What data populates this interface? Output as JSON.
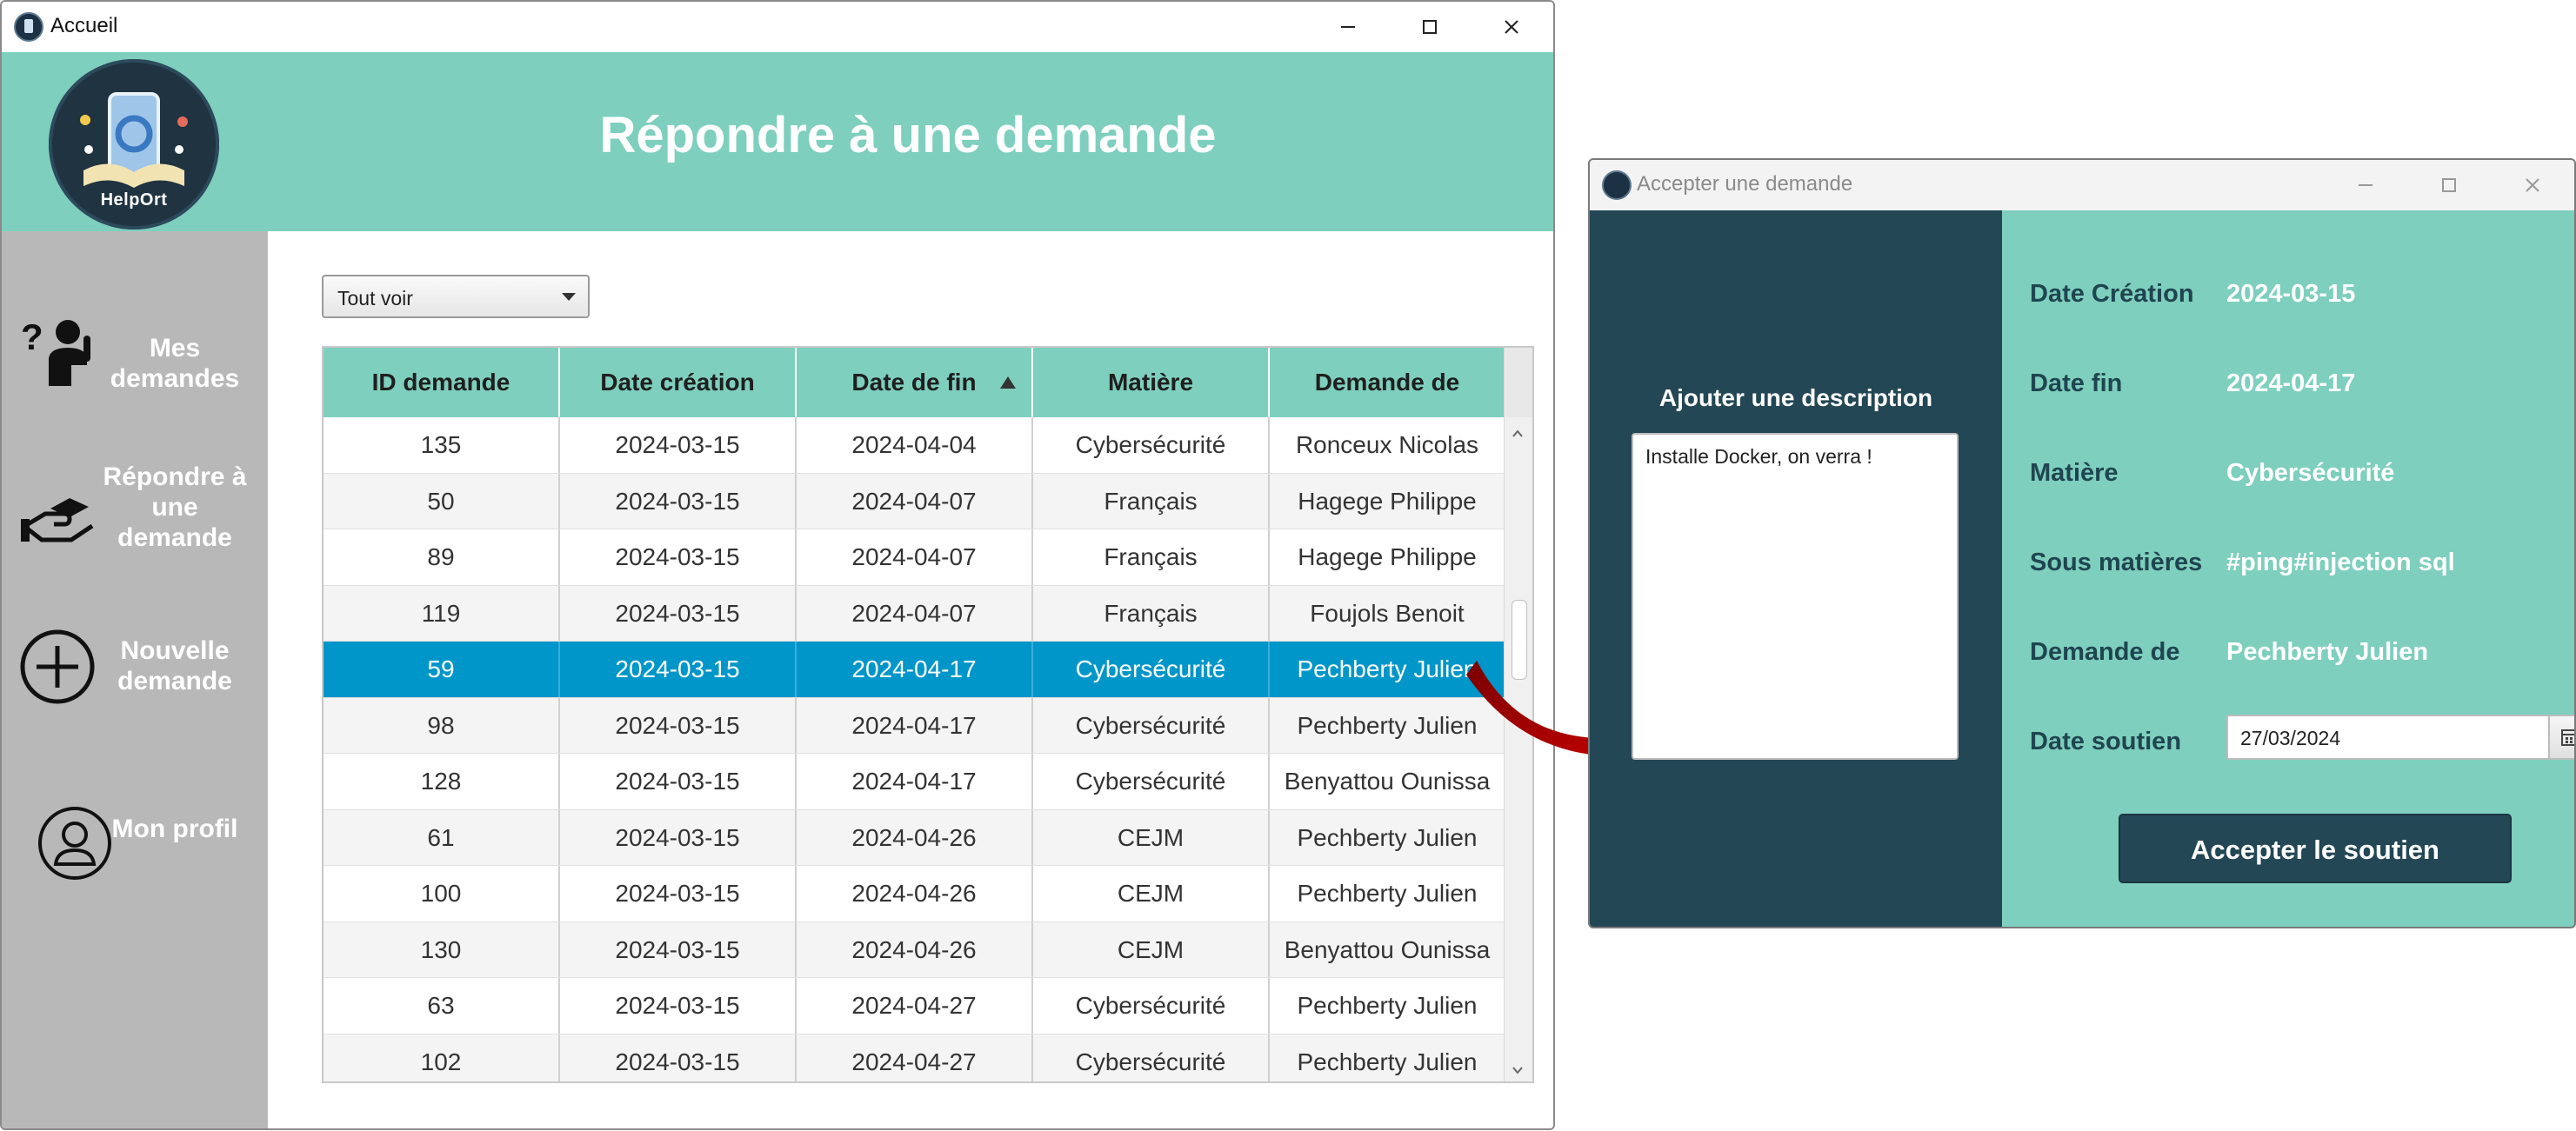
{
  "main_window": {
    "title": "Accueil",
    "header_title": "Répondre à une demande",
    "logo_text": "HelpOrt"
  },
  "sidebar": {
    "items": [
      {
        "label": "Mes demandes",
        "icon": "help-person-icon"
      },
      {
        "label": "Répondre à une demande",
        "icon": "helping-hand-icon"
      },
      {
        "label": "Nouvelle demande",
        "icon": "plus-circle-icon"
      },
      {
        "label": "Mon profil",
        "icon": "user-circle-icon"
      }
    ]
  },
  "filter": {
    "selected": "Tout voir"
  },
  "table": {
    "columns": [
      "ID demande",
      "Date création",
      "Date de fin",
      "Matière",
      "Demande de"
    ],
    "sorted_column": "Date de fin",
    "sort_direction": "ascending",
    "selected_row_id": "59",
    "rows": [
      [
        "135",
        "2024-03-15",
        "2024-04-04",
        "Cybersécurité",
        "Ronceux Nicolas"
      ],
      [
        "50",
        "2024-03-15",
        "2024-04-07",
        "Français",
        "Hagege Philippe"
      ],
      [
        "89",
        "2024-03-15",
        "2024-04-07",
        "Français",
        "Hagege Philippe"
      ],
      [
        "119",
        "2024-03-15",
        "2024-04-07",
        "Français",
        "Foujols Benoit"
      ],
      [
        "59",
        "2024-03-15",
        "2024-04-17",
        "Cybersécurité",
        "Pechberty Julien"
      ],
      [
        "98",
        "2024-03-15",
        "2024-04-17",
        "Cybersécurité",
        "Pechberty Julien"
      ],
      [
        "128",
        "2024-03-15",
        "2024-04-17",
        "Cybersécurité",
        "Benyattou Ounissa"
      ],
      [
        "61",
        "2024-03-15",
        "2024-04-26",
        "CEJM",
        "Pechberty Julien"
      ],
      [
        "100",
        "2024-03-15",
        "2024-04-26",
        "CEJM",
        "Pechberty Julien"
      ],
      [
        "130",
        "2024-03-15",
        "2024-04-26",
        "CEJM",
        "Benyattou Ounissa"
      ],
      [
        "63",
        "2024-03-15",
        "2024-04-27",
        "Cybersécurité",
        "Pechberty Julien"
      ],
      [
        "102",
        "2024-03-15",
        "2024-04-27",
        "Cybersécurité",
        "Pechberty Julien"
      ]
    ]
  },
  "dialog": {
    "title": "Accepter une demande",
    "description_label": "Ajouter une description",
    "description_value": "Installe Docker, on verra !",
    "fields": [
      {
        "label": "Date Création",
        "value": "2024-03-15"
      },
      {
        "label": "Date fin",
        "value": "2024-04-17"
      },
      {
        "label": "Matière",
        "value": "Cybersécurité"
      },
      {
        "label": "Sous matières",
        "value": "#ping#injection sql"
      },
      {
        "label": "Demande de",
        "value": "Pechberty Julien"
      }
    ],
    "date_soutien_label": "Date soutien",
    "date_soutien_value": "27/03/2024",
    "accept_button": "Accepter le soutien"
  },
  "colors": {
    "accent_teal": "#7ecfbd",
    "dark_teal": "#234755",
    "sidebar_gray": "#b8b8b8",
    "selection_blue": "#0096c9",
    "arrow_red": "#c00000"
  }
}
